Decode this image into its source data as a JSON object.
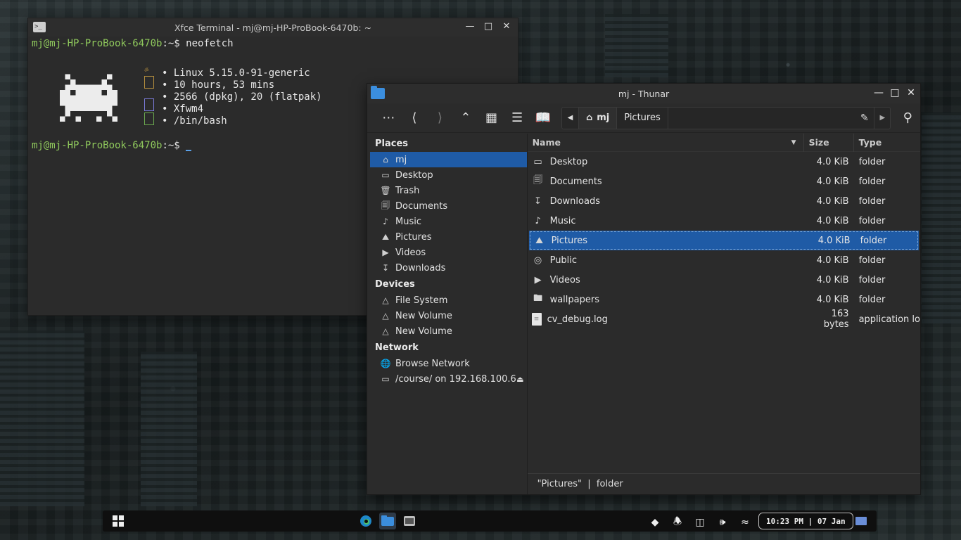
{
  "terminal": {
    "title": "Xfce Terminal - mj@mj-HP-ProBook-6470b: ~",
    "prompt_user": "mj@mj-HP-ProBook-6470b",
    "prompt_suffix": ":~$ ",
    "command": "neofetch",
    "info": [
      "• Linux 5.15.0-91-generic",
      "• 10 hours, 53 mins",
      "• 2566 (dpkg), 20 (flatpak)",
      "• Xfwm4",
      "• /bin/bash"
    ],
    "second_prompt_suffix": ":~$ "
  },
  "thunar": {
    "title": "mj - Thunar",
    "path": {
      "home": "mj",
      "current": "Pictures"
    },
    "sidebar": {
      "places_heading": "Places",
      "places": [
        {
          "label": "mj",
          "icon": "home-icon",
          "selected": true
        },
        {
          "label": "Desktop",
          "icon": "desktop-icon"
        },
        {
          "label": "Trash",
          "icon": "trash-icon"
        },
        {
          "label": "Documents",
          "icon": "documents-icon"
        },
        {
          "label": "Music",
          "icon": "music-icon"
        },
        {
          "label": "Pictures",
          "icon": "pictures-icon"
        },
        {
          "label": "Videos",
          "icon": "videos-icon"
        },
        {
          "label": "Downloads",
          "icon": "downloads-icon"
        }
      ],
      "devices_heading": "Devices",
      "devices": [
        {
          "label": "File System"
        },
        {
          "label": "New Volume"
        },
        {
          "label": "New Volume"
        }
      ],
      "network_heading": "Network",
      "network": [
        {
          "label": "Browse Network",
          "icon": "globe-icon"
        },
        {
          "label": "/course/ on 192.168.100.6",
          "icon": "network-folder-icon"
        }
      ]
    },
    "columns": {
      "name": "Name",
      "size": "Size",
      "type": "Type"
    },
    "files": [
      {
        "name": "Desktop",
        "size": "4.0 KiB",
        "type": "folder",
        "icon": "desktop-icon"
      },
      {
        "name": "Documents",
        "size": "4.0 KiB",
        "type": "folder",
        "icon": "documents-icon"
      },
      {
        "name": "Downloads",
        "size": "4.0 KiB",
        "type": "folder",
        "icon": "downloads-icon"
      },
      {
        "name": "Music",
        "size": "4.0 KiB",
        "type": "folder",
        "icon": "music-icon"
      },
      {
        "name": "Pictures",
        "size": "4.0 KiB",
        "type": "folder",
        "icon": "pictures-icon",
        "selected": true
      },
      {
        "name": "Public",
        "size": "4.0 KiB",
        "type": "folder",
        "icon": "public-icon"
      },
      {
        "name": "Videos",
        "size": "4.0 KiB",
        "type": "folder",
        "icon": "videos-icon"
      },
      {
        "name": "wallpapers",
        "size": "4.0 KiB",
        "type": "folder",
        "icon": "folder-icon"
      },
      {
        "name": "cv_debug.log",
        "size": "163 bytes",
        "type": "application lo",
        "icon": "file-icon"
      }
    ],
    "status": "\"Pictures\"  |  folder"
  },
  "taskbar": {
    "clock": "10:23 PM | 07 Jan"
  },
  "colors": {
    "accent": "#1f5ba6",
    "prompt": "#8fc85c",
    "thunar_icon": "#3b8ede"
  }
}
